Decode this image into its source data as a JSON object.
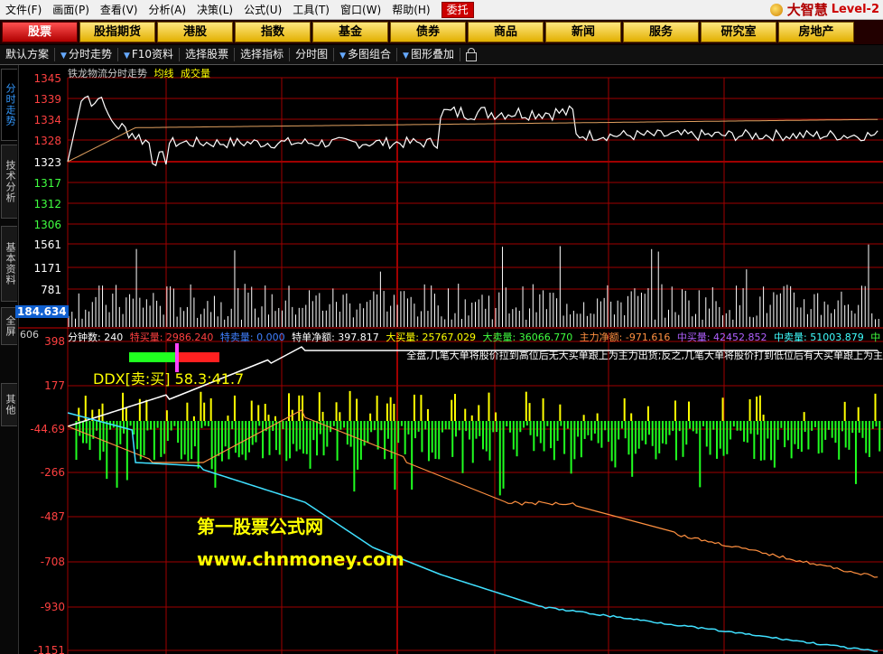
{
  "menus": [
    "文件(F)",
    "画面(P)",
    "查看(V)",
    "分析(A)",
    "决策(L)",
    "公式(U)",
    "工具(T)",
    "窗口(W)",
    "帮助(H)"
  ],
  "trust_label": "委托",
  "brand": {
    "name": "大智慧",
    "level": "Level-2"
  },
  "nav_tabs": [
    "股票",
    "股指期货",
    "港股",
    "指数",
    "基金",
    "债券",
    "商品",
    "新闻",
    "服务",
    "研究室",
    "房地产"
  ],
  "active_nav": "股票",
  "toolbar": [
    {
      "label": "默认方案",
      "arrow": true
    },
    {
      "label": "分时走势",
      "arrow": true
    },
    {
      "label": "F10资料",
      "arrow": false
    },
    {
      "label": "选择股票",
      "arrow": false
    },
    {
      "label": "选择指标",
      "arrow": false
    },
    {
      "label": "分时图",
      "arrow": true
    },
    {
      "label": "多图组合",
      "arrow": true
    },
    {
      "label": "图形叠加",
      "arrow": false
    }
  ],
  "side_tabs": [
    "分时走势",
    "技术分析",
    "基本资料",
    "全屏",
    "其他"
  ],
  "stock_info": {
    "name": "铁龙物流分时走势",
    "ma_label": "均线",
    "vol_label": "成交量"
  },
  "price_axis": [
    {
      "v": "1345",
      "c": "#ff4040"
    },
    {
      "v": "1339",
      "c": "#ff4040"
    },
    {
      "v": "1334",
      "c": "#ff4040"
    },
    {
      "v": "1328",
      "c": "#ff4040"
    },
    {
      "v": "1323",
      "c": "#ffffff"
    },
    {
      "v": "1317",
      "c": "#40ff40"
    },
    {
      "v": "1312",
      "c": "#40ff40"
    },
    {
      "v": "1306",
      "c": "#40ff40"
    }
  ],
  "volume_axis": [
    "1561",
    "1171",
    "781"
  ],
  "volume_current": "184.634",
  "volume_current_2": "606",
  "ddx_axis": [
    "398",
    "177",
    "-44.69",
    "-266",
    "-487",
    "-708",
    "-930",
    "-1151"
  ],
  "stats": [
    {
      "label": "分钟数: 240",
      "color": "#ffffff"
    },
    {
      "label": "特买量: 2986.240",
      "color": "#ff4040"
    },
    {
      "label": "特卖量: 0.000",
      "color": "#4080ff"
    },
    {
      "label": "特单净额: 397.817",
      "color": "#ffffff"
    },
    {
      "label": "大买量: 25767.029",
      "color": "#ffff00"
    },
    {
      "label": "大卖量: 36066.770",
      "color": "#40ff40"
    },
    {
      "label": "主力净额: -971.616",
      "color": "#ff9040"
    },
    {
      "label": "中买量: 42452.852",
      "color": "#b060ff"
    },
    {
      "label": "中卖量: 51003.879",
      "color": "#40ffff"
    },
    {
      "label": "中",
      "color": "#40ff40"
    }
  ],
  "commentary": "全盘,几笔大单将股价拉到高位后无大买单跟上为主力出货;反之,几笔大单将股价打到低位后有大买单跟上为主",
  "ddx_label": "DDX[卖:买] 58.3:41.7",
  "watermark": {
    "line1": "第一股票公式网",
    "line2": "www.chnmoney.com"
  },
  "colors": {
    "price_line": "#ffffff",
    "avg_line": "#e0a060",
    "grid": "#a00000",
    "volume": "#ffffff",
    "buy": "#ffff00",
    "sell": "#20ff20",
    "net_line": "#ffffff",
    "main_line": "#ff9040",
    "mid_line": "#40e0ff"
  }
}
